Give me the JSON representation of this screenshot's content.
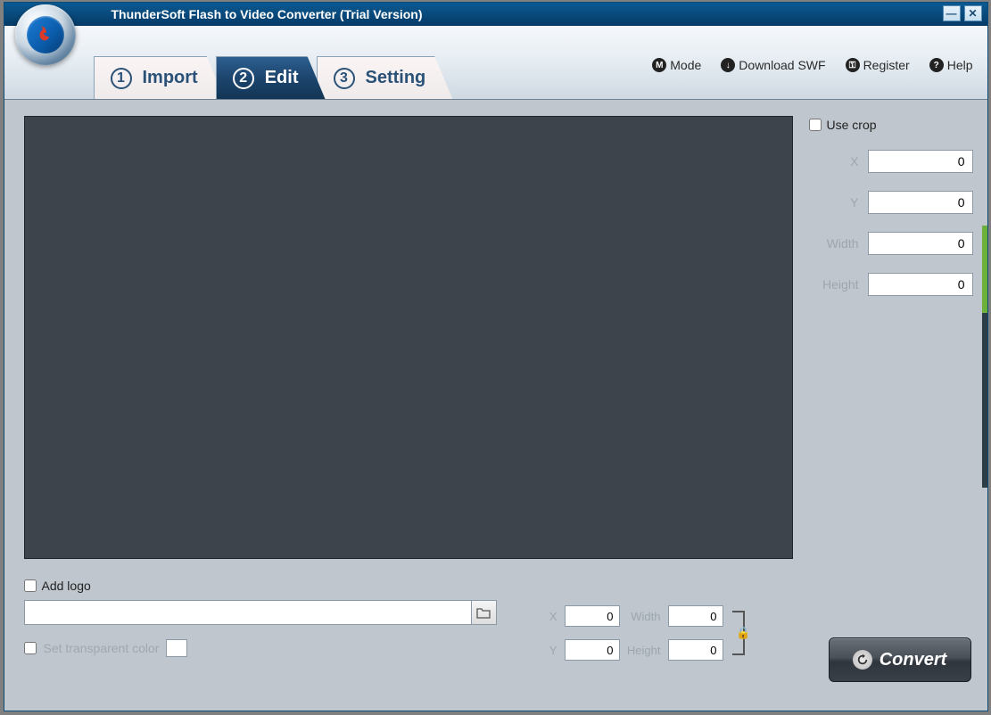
{
  "title": "ThunderSoft Flash to Video Converter (Trial Version)",
  "tabs": [
    {
      "num": "1",
      "label": "Import"
    },
    {
      "num": "2",
      "label": "Edit"
    },
    {
      "num": "3",
      "label": "Setting"
    }
  ],
  "toolbar": {
    "mode": "Mode",
    "download": "Download SWF",
    "register": "Register",
    "help": "Help"
  },
  "crop": {
    "use_crop_label": "Use crop",
    "x_label": "X",
    "x_value": "0",
    "y_label": "Y",
    "y_value": "0",
    "width_label": "Width",
    "width_value": "0",
    "height_label": "Height",
    "height_value": "0"
  },
  "logo": {
    "add_logo_label": "Add logo",
    "path_value": "",
    "transparent_label": "Set transparent color",
    "x_label": "X",
    "x_value": "0",
    "y_label": "Y",
    "y_value": "0",
    "width_label": "Width",
    "width_value": "0",
    "height_label": "Height",
    "height_value": "0"
  },
  "convert_label": "Convert"
}
